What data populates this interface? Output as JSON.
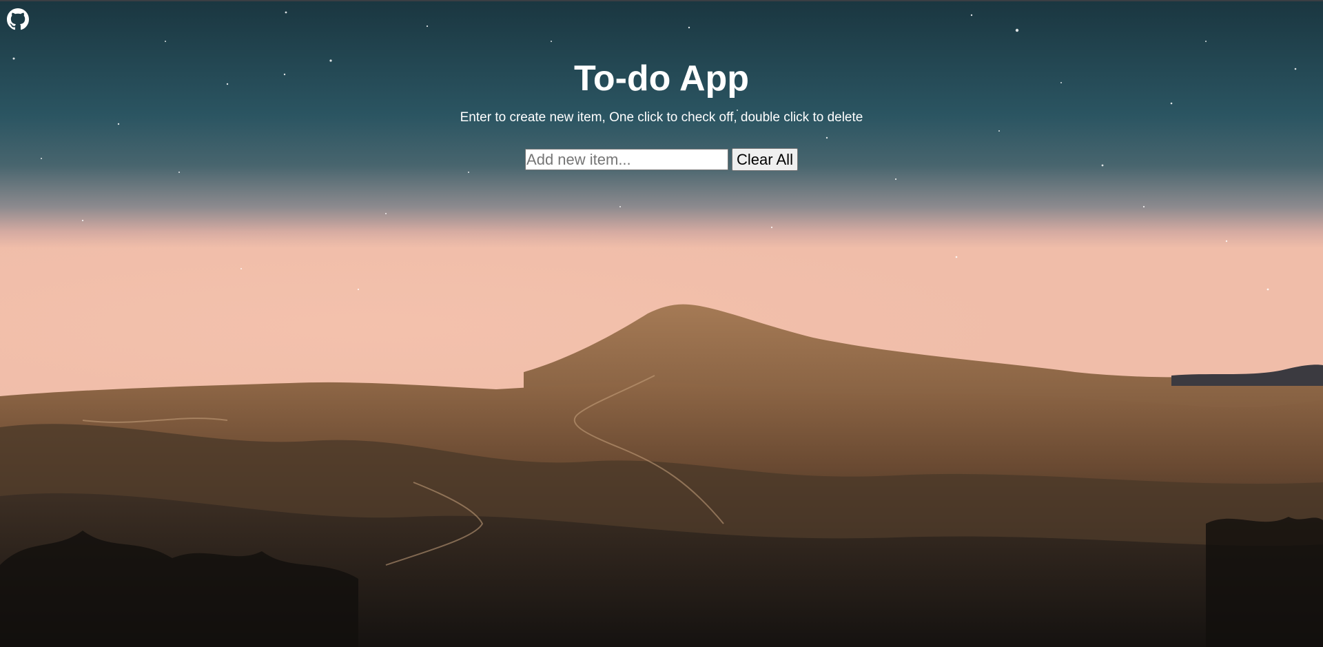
{
  "header": {
    "title": "To-do App",
    "instructions": "Enter to create new item, One click to check off, double click to delete"
  },
  "form": {
    "input_placeholder": "Add new item...",
    "input_value": "",
    "clear_label": "Clear All"
  },
  "icons": {
    "corner_link": "github-icon"
  },
  "colors": {
    "text": "#ffffff",
    "sky_top": "#19353f",
    "sky_mid": "#2f5661",
    "horizon_glow": "#e9b7a5",
    "mountain": "#8c6544",
    "ground_dark": "#1e1a16"
  }
}
